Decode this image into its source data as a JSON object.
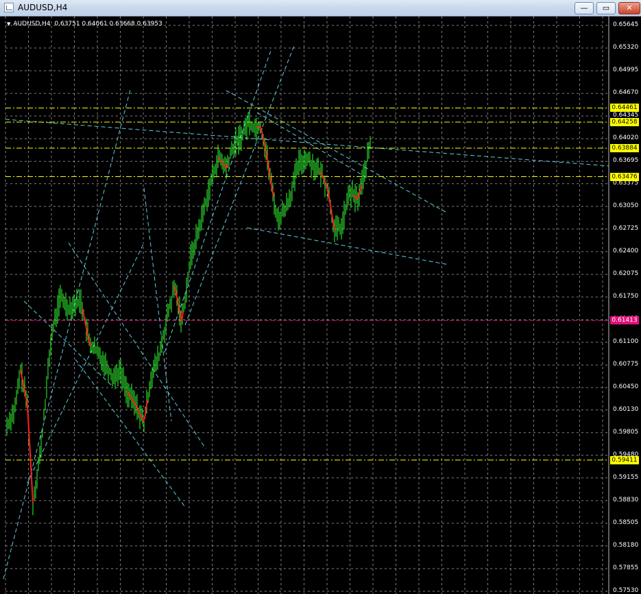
{
  "window": {
    "title": "AUDUSD,H4",
    "buttons": {
      "minimize": "—",
      "maximize": "▭",
      "close": "✕"
    }
  },
  "chart": {
    "symbol": "AUDUSD,H4",
    "ohlc": "0.63751 0.64061 0.63668 0.63953",
    "price_labels": [
      "0.65645",
      "0.65320",
      "0.64995",
      "0.64670",
      "0.64345",
      "0.64020",
      "0.63695",
      "0.63375",
      "0.63050",
      "0.62725",
      "0.62400",
      "0.62075",
      "0.61750",
      "0.61425",
      "0.61100",
      "0.60775",
      "0.60450",
      "0.60130",
      "0.59805",
      "0.59480",
      "0.59155",
      "0.58830",
      "0.58505",
      "0.58180",
      "0.57855",
      "0.57530"
    ],
    "level_labels": [
      {
        "value": "0.64461",
        "color": "#ffff00",
        "kind": "yellow"
      },
      {
        "value": "0.64258",
        "color": "#ffff00",
        "kind": "yellow"
      },
      {
        "value": "0.63884",
        "color": "#ffff00",
        "kind": "yellow"
      },
      {
        "value": "0.63476",
        "color": "#ffff00",
        "kind": "yellow"
      },
      {
        "value": "0.61413",
        "color": "#e0107a",
        "kind": "magenta"
      },
      {
        "value": "0.59411",
        "color": "#ffff00",
        "kind": "yellow"
      }
    ],
    "colors": {
      "background": "#000000",
      "grid": "#b0b0b0",
      "candles": "#32ff32",
      "ma_line": "#ff1e1e",
      "trendlines": "#5fd0e0"
    }
  }
}
